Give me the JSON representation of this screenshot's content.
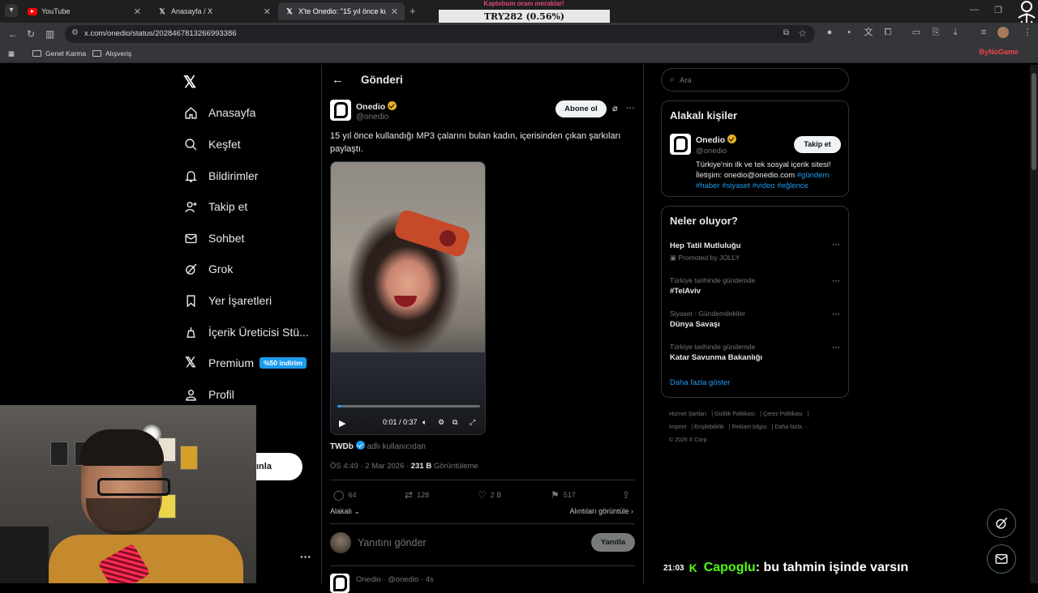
{
  "browser": {
    "tabs": [
      {
        "title": "YouTube",
        "icon": "youtube-icon"
      },
      {
        "title": "Anasayfa / X",
        "icon": "x-icon"
      },
      {
        "title": "X'te Onedio: \"15 yıl önce kullan",
        "icon": "x-icon"
      }
    ],
    "overlay_top": "Kaptebum oranı meraklar!",
    "overlay_box": "TRY282 (0.56%)",
    "url": "x.com/onedio/status/2028467813266993386",
    "bookmarks": [
      "Genel Karma",
      "Alışveriş"
    ],
    "brand_badge": "ByNoGame"
  },
  "nav": {
    "items": [
      {
        "label": "Anasayfa",
        "icon": "home-icon"
      },
      {
        "label": "Keşfet",
        "icon": "search-icon"
      },
      {
        "label": "Bildirimler",
        "icon": "bell-icon"
      },
      {
        "label": "Takip et",
        "icon": "add-user-icon"
      },
      {
        "label": "Sohbet",
        "icon": "mail-icon"
      },
      {
        "label": "Grok",
        "icon": "grok-icon"
      },
      {
        "label": "Yer İşaretleri",
        "icon": "bookmark-icon"
      },
      {
        "label": "İçerik Üreticisi Stü...",
        "icon": "creator-studio-icon"
      },
      {
        "label": "Premium",
        "icon": "x-premium-icon"
      },
      {
        "label": "Profil",
        "icon": "profile-icon"
      }
    ],
    "premium_badge": "%50 indirim",
    "post_button_fragment": "ınla"
  },
  "post": {
    "page_title": "Gönderi",
    "author_name": "Onedio",
    "author_handle": "@onedio",
    "subscribe_label": "Abone ol",
    "text": "15 yıl önce kullandığı MP3 çalarını bulan kadın, içerisinden çıkan şarkıları paylaştı.",
    "video": {
      "time": "0:01 / 0:37",
      "progress": 0.03
    },
    "source_name": "TWDb",
    "source_suffix": "adlı kullanıcıdan",
    "timestamp": "ÖS 4:49 · 2 Mar 2026 · ",
    "views_count": "231 B",
    "views_label": " Görüntüleme",
    "stats": {
      "replies": "64",
      "reposts": "128",
      "likes": "2 B",
      "bookmarks": "517"
    },
    "related_label": "Alakalı",
    "quotes_label": "Alıntıları görüntüle",
    "reply_placeholder": "Yanıtını gönder",
    "reply_button": "Yanıtla",
    "next_tweet": "Onedio · @onedio · 4s"
  },
  "sidebar": {
    "search_placeholder": "Ara",
    "related_people": {
      "title": "Alakalı kişiler",
      "name": "Onedio",
      "handle": "@onedio",
      "follow_label": "Takip et",
      "bio": "Türkiye'nin ilk ve tek sosyal içerik sitesi! İletişim: onedio@onedio.com ",
      "bio_tags": "#gündem #haber #siyaset #video #eğlence"
    },
    "trends": {
      "title": "Neler oluyor?",
      "items": [
        {
          "meta": "Promoted by JOLLY",
          "name": "Hep Tatil Mutluluğu",
          "promoted": true
        },
        {
          "meta": "Türkiye tarihinde gündemde",
          "name": "#TelAviv"
        },
        {
          "meta": "Siyaset · Gündemdekiler",
          "name": "Dünya Savaşı"
        },
        {
          "meta": "Türkiye tarihinde gündemde",
          "name": "Katar Savunma Bakanlığı"
        }
      ],
      "show_more": "Daha fazla göster"
    },
    "footer": [
      "Hizmet Şartları",
      "Gizlilik Politikası",
      "Çerez Politikası",
      "Imprint",
      "Erişilebilirlik",
      "Reklam bilgisi",
      "Daha fazla ···",
      "© 2026 X Corp."
    ]
  },
  "stream": {
    "chat_time": "21:03",
    "chat_user": "Capoglu",
    "chat_message": ": bu tahmin işinde varsın"
  }
}
